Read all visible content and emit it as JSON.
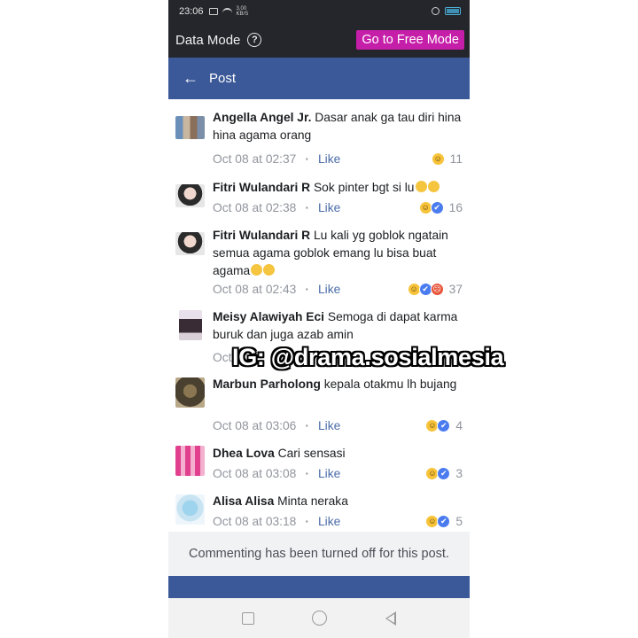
{
  "status_bar": {
    "time": "23:06",
    "speed": "3,00\nKB/S"
  },
  "data_mode": {
    "title": "Data Mode",
    "help_icon": "question-circle-icon",
    "free_mode_label": "Go to Free Mode"
  },
  "header": {
    "back_icon": "arrow-left-icon",
    "title": "Post"
  },
  "comments": [
    {
      "name": "Angella Angel Jr.",
      "text": "Dasar anak ga tau diri hina hina agama orang",
      "time": "Oct 08 at 02:37",
      "like": "Like",
      "reactions": [
        "haha"
      ],
      "count": "11"
    },
    {
      "name": "Fitri Wulandari R",
      "text": "Sok pinter bgt si lu",
      "time": "Oct 08 at 02:38",
      "like": "Like",
      "reactions": [
        "haha",
        "like"
      ],
      "count": "16"
    },
    {
      "name": "Fitri Wulandari R",
      "text": "Lu kali yg goblok ngatain semua agama goblok emang lu bisa buat agama",
      "time": "Oct 08 at 02:43",
      "like": "Like",
      "reactions": [
        "haha",
        "like",
        "angry"
      ],
      "count": "37"
    },
    {
      "name": "Meisy Alawiyah Eci",
      "text": "Semoga di dapat karma buruk dan juga azab amin",
      "time": "Oct",
      "like": "",
      "reactions": [],
      "count": ""
    },
    {
      "name": "Marbun Parholong",
      "text": "kepala otakmu lh bujang",
      "time": "Oct 08 at 03:06",
      "like": "Like",
      "reactions": [
        "haha",
        "like"
      ],
      "count": "4"
    },
    {
      "name": "Dhea Lova",
      "text": "Cari sensasi",
      "time": "Oct 08 at 03:08",
      "like": "Like",
      "reactions": [
        "haha",
        "like"
      ],
      "count": "3"
    },
    {
      "name": "Alisa Alisa",
      "text": "Minta neraka",
      "time": "Oct 08 at 03:18",
      "like": "Like",
      "reactions": [
        "haha",
        "like"
      ],
      "count": "5"
    }
  ],
  "watermark": "IG: @drama.sosialmesia",
  "footer": {
    "disabled_note": "Commenting has been turned off for this post."
  },
  "colors": {
    "fb_blue": "#3b5998",
    "free_mode": "#c51ea8",
    "like_link": "#4b6ca8",
    "meta_gray": "#90949c"
  }
}
